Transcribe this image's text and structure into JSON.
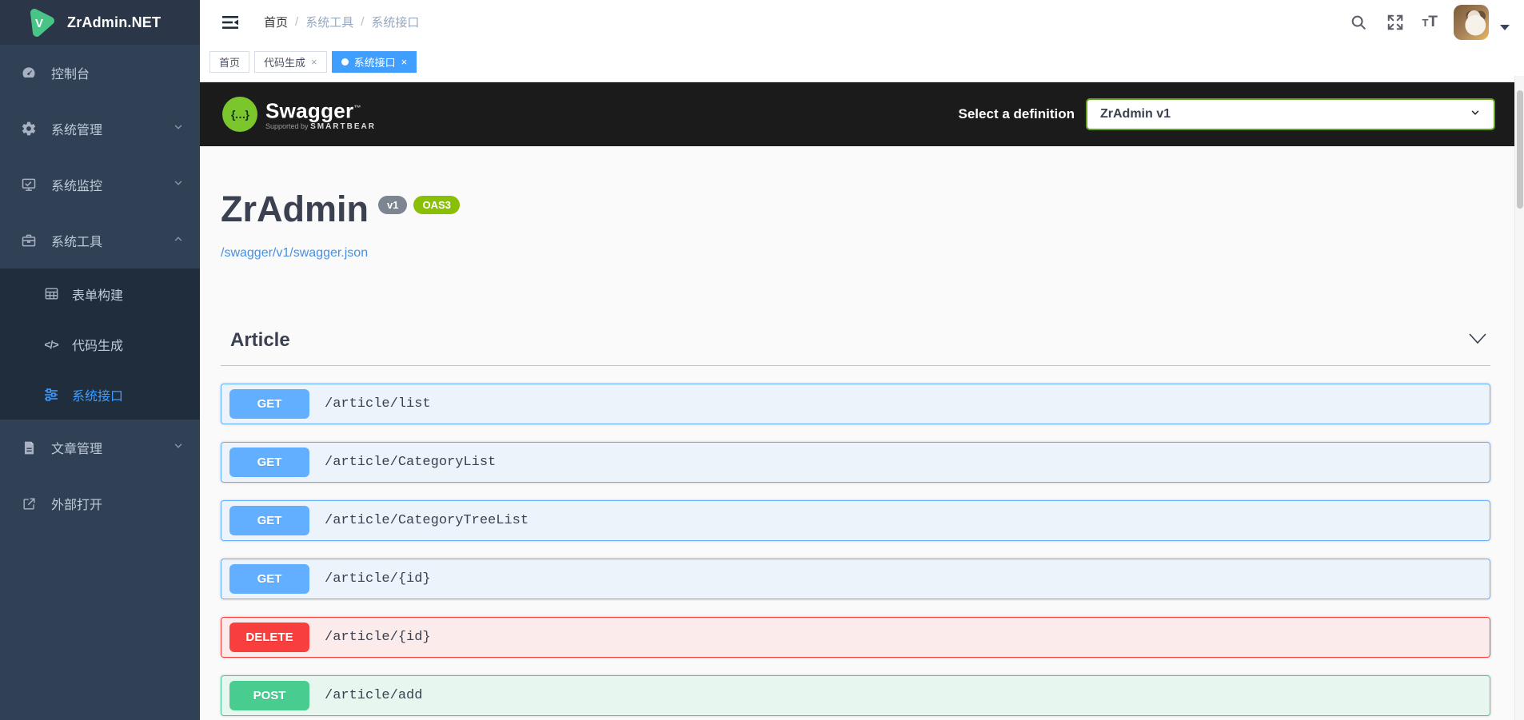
{
  "app": {
    "name": "ZrAdmin.NET",
    "logo_letter": "V"
  },
  "sidebar": {
    "items": [
      {
        "label": "控制台",
        "icon": "dashboard-icon"
      },
      {
        "label": "系统管理",
        "icon": "gear-icon",
        "chevron": "down"
      },
      {
        "label": "系统监控",
        "icon": "monitor-icon",
        "chevron": "down"
      },
      {
        "label": "系统工具",
        "icon": "toolbox-icon",
        "chevron": "up",
        "expanded": true
      },
      {
        "label": "表单构建",
        "icon": "table-icon"
      },
      {
        "label": "代码生成",
        "icon": "code-icon",
        "code_glyph": "</>"
      },
      {
        "label": "系统接口",
        "icon": "sliders-icon",
        "active": true
      },
      {
        "label": "文章管理",
        "icon": "document-icon",
        "chevron": "down"
      },
      {
        "label": "外部打开",
        "icon": "external-link-icon"
      }
    ]
  },
  "navbar": {
    "breadcrumb": {
      "items": [
        "首页",
        "系统工具",
        "系统接口"
      ],
      "separator": "/"
    },
    "icons": [
      "collapse-sidebar-icon",
      "search-icon",
      "fullscreen-icon",
      "font-size-icon",
      "avatar",
      "caret-down-icon"
    ],
    "font_size_glyph_small": "T",
    "font_size_glyph_large": "T"
  },
  "tabbar": {
    "tabs": [
      {
        "label": "首页",
        "active": false,
        "closable": false
      },
      {
        "label": "代码生成",
        "active": false,
        "closable": true,
        "close_glyph": "×"
      },
      {
        "label": "系统接口",
        "active": true,
        "closable": true,
        "close_glyph": "×"
      }
    ]
  },
  "swagger": {
    "brand": {
      "name": "Swagger",
      "tm": "™",
      "supported_by": "Supported by",
      "sponsor": "SMARTBEAR",
      "logo_glyph": "{…}"
    },
    "definition": {
      "label": "Select a definition",
      "selected": "ZrAdmin v1"
    },
    "info": {
      "title": "ZrAdmin",
      "version_badge": "v1",
      "oas_badge": "OAS3",
      "spec_link": "/swagger/v1/swagger.json"
    },
    "sections": [
      {
        "title": "Article",
        "endpoints": [
          {
            "method": "GET",
            "path": "/article/list"
          },
          {
            "method": "GET",
            "path": "/article/CategoryList"
          },
          {
            "method": "GET",
            "path": "/article/CategoryTreeList"
          },
          {
            "method": "GET",
            "path": "/article/{id}"
          },
          {
            "method": "DELETE",
            "path": "/article/{id}"
          },
          {
            "method": "POST",
            "path": "/article/add"
          }
        ]
      }
    ]
  },
  "colors": {
    "accent_blue": "#409eff",
    "sidebar_bg": "#304156",
    "submenu_bg": "#1f2d3d",
    "swagger_topbar_bg": "#1b1b1b",
    "method_get": "#61affe",
    "method_post": "#49cc90",
    "method_delete": "#f93e3e",
    "oas3_badge": "#89bf04",
    "version_badge": "#7d8492",
    "link_blue": "#4990e2"
  }
}
